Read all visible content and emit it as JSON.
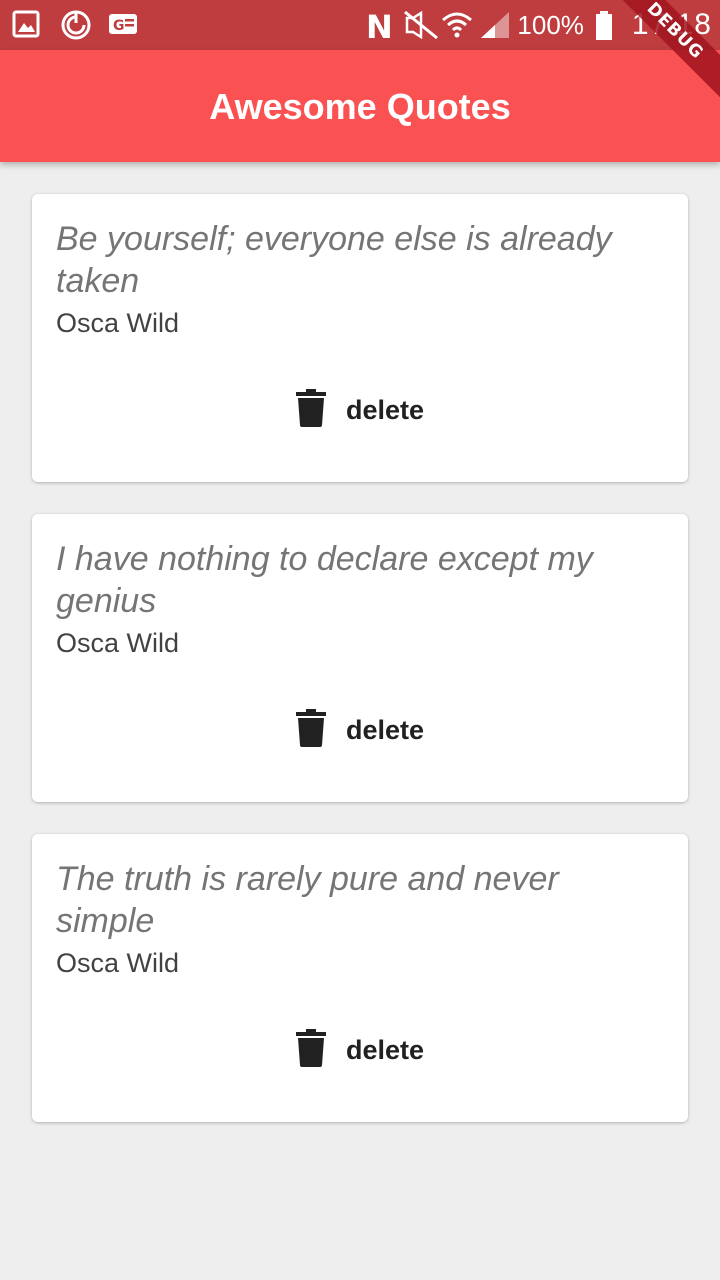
{
  "status_bar": {
    "icons_left": [
      "gallery-icon",
      "sync-icon",
      "news-icon"
    ],
    "icons_right": [
      "nfc-icon",
      "mute-icon",
      "wifi-icon",
      "signal-icon"
    ],
    "battery": "100%",
    "time": "17:18"
  },
  "app_bar": {
    "title": "Awesome Quotes"
  },
  "debug_banner": "DEBUG",
  "quotes": [
    {
      "text": "Be yourself; everyone else is already taken",
      "author": "Osca Wild",
      "delete_label": "delete"
    },
    {
      "text": "I have nothing to declare except my genius",
      "author": "Osca Wild",
      "delete_label": "delete"
    },
    {
      "text": "The truth is rarely pure and never simple",
      "author": "Osca Wild",
      "delete_label": "delete"
    }
  ],
  "colors": {
    "app_bar": "#fa5252",
    "status_bar": "#bf3d3f",
    "background": "#eeeeee"
  }
}
